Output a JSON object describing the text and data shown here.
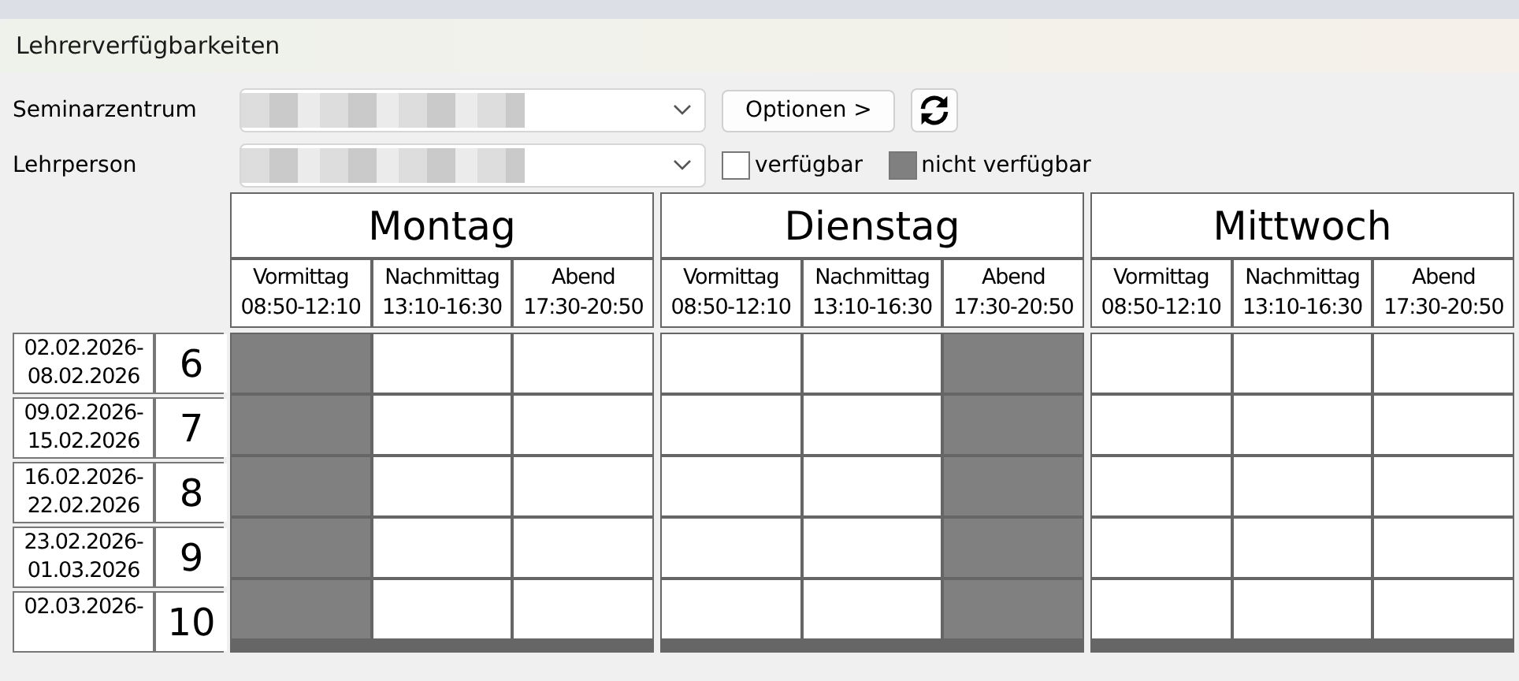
{
  "window": {
    "title": "Lehrerverfügbarkeiten"
  },
  "filters": [
    {
      "label": "Seminarzentrum",
      "value_hidden": true
    },
    {
      "label": "Lehrperson",
      "value_hidden": true
    }
  ],
  "options_button": "Optionen >",
  "legend": [
    {
      "label": "verfügbar",
      "available": true
    },
    {
      "label": "nicht verfügbar",
      "available": false
    }
  ],
  "days": [
    {
      "name": "Montag",
      "slots": [
        {
          "name": "Vormittag",
          "time": "08:50-12:10"
        },
        {
          "name": "Nachmittag",
          "time": "13:10-16:30"
        },
        {
          "name": "Abend",
          "time": "17:30-20:50"
        }
      ]
    },
    {
      "name": "Dienstag",
      "slots": [
        {
          "name": "Vormittag",
          "time": "08:50-12:10"
        },
        {
          "name": "Nachmittag",
          "time": "13:10-16:30"
        },
        {
          "name": "Abend",
          "time": "17:30-20:50"
        }
      ]
    },
    {
      "name": "Mittwoch",
      "slots": [
        {
          "name": "Vormittag",
          "time": "08:50-12:10"
        },
        {
          "name": "Nachmittag",
          "time": "13:10-16:30"
        },
        {
          "name": "Abend",
          "time": "17:30-20:50"
        }
      ]
    }
  ],
  "weeks": [
    {
      "range_start": "02.02.2026-",
      "range_end": "08.02.2026",
      "week": "6",
      "available": [
        false,
        true,
        true,
        true,
        true,
        false,
        true,
        true,
        true
      ]
    },
    {
      "range_start": "09.02.2026-",
      "range_end": "15.02.2026",
      "week": "7",
      "available": [
        false,
        true,
        true,
        true,
        true,
        false,
        true,
        true,
        true
      ]
    },
    {
      "range_start": "16.02.2026-",
      "range_end": "22.02.2026",
      "week": "8",
      "available": [
        false,
        true,
        true,
        true,
        true,
        false,
        true,
        true,
        true
      ]
    },
    {
      "range_start": "23.02.2026-",
      "range_end": "01.03.2026",
      "week": "9",
      "available": [
        false,
        true,
        true,
        true,
        true,
        false,
        true,
        true,
        true
      ]
    },
    {
      "range_start": "02.03.2026-",
      "week": "10",
      "available": [
        false,
        true,
        true,
        true,
        true,
        false,
        true,
        true,
        true
      ]
    }
  ]
}
